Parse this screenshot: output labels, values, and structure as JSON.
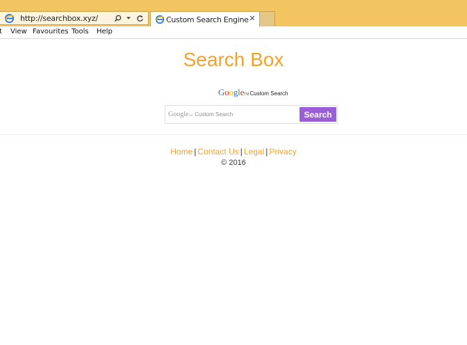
{
  "browser": {
    "address_url": "http://searchbox.xyz/",
    "tab_title": "Custom Search Engine",
    "tab_close": "✕",
    "menu": {
      "edit_fragment": "t",
      "view": "View",
      "favourites": "Favourites",
      "tools": "Tools",
      "help": "Help"
    },
    "icons": {
      "address_search": "search-icon",
      "address_dropdown": "chevron-down-icon",
      "address_refresh": "refresh-icon",
      "tab_close": "close-icon",
      "ie": "ie-logo-icon"
    },
    "colors": {
      "chrome": "#f2c561",
      "tab_border": "#c9a248"
    }
  },
  "page": {
    "title": "Search Box",
    "google_brand": {
      "logo_text": "Google",
      "tm": "TM",
      "label": "Custom Search"
    },
    "search": {
      "placeholder_logo": "Google",
      "placeholder_tm": "TM",
      "placeholder_label": "Custom Search",
      "button_label": "Search",
      "value": ""
    },
    "footer": {
      "links": [
        "Home",
        "Contact Us",
        "Legal",
        "Privacy"
      ],
      "separator": "|",
      "copyright": "© 2016"
    },
    "colors": {
      "accent": "#f7a12b",
      "button": "#9a5fd6"
    }
  }
}
